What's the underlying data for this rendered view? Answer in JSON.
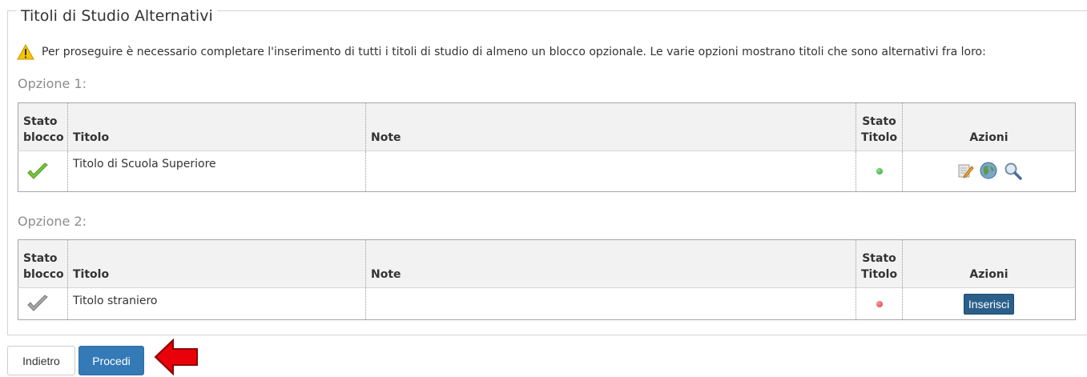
{
  "section": {
    "title": "Titoli di Studio Alternativi",
    "notice": "Per proseguire è necessario completare l'inserimento di tutti i titoli di studio di almeno un blocco opzionale. Le varie opzioni mostrano titoli che sono alternativi fra loro:"
  },
  "table_headers": {
    "stato_blocco_l1": "Stato",
    "stato_blocco_l2": "blocco",
    "titolo": "Titolo",
    "note": "Note",
    "stato_titolo_l1": "Stato",
    "stato_titolo_l2": "Titolo",
    "azioni": "Azioni"
  },
  "options": [
    {
      "label": "Opzione 1:",
      "row": {
        "titolo": "Titolo di Scuola Superiore",
        "note": "",
        "block_status_icon": "check-green-icon",
        "title_status_color": "#2e9e2e"
      }
    },
    {
      "label": "Opzione 2:",
      "row": {
        "titolo": "Titolo straniero",
        "note": "",
        "block_status_icon": "check-grey-icon",
        "title_status_color": "#d9363e",
        "action_label": "Inserisci"
      }
    }
  ],
  "buttons": {
    "back": "Indietro",
    "next": "Procedi"
  },
  "colors": {
    "primary": "#337ab7",
    "dark_button": "#2a5f8a"
  }
}
